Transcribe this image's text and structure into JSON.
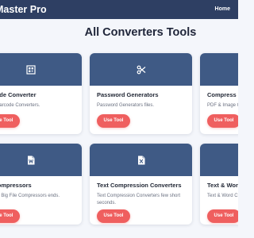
{
  "navbar": {
    "brand": "Master Pro",
    "home_link": "Home"
  },
  "page": {
    "title": "All Converters Tools"
  },
  "cards": [
    {
      "title": "e Code Converter",
      "description": "QR, Barcode Converters.",
      "button": "Use Tool",
      "icon": "qr-code-icon"
    },
    {
      "title": "Password Generators",
      "description": "Password Generators files.",
      "button": "Use Tool",
      "icon": "scissors-icon"
    },
    {
      "title": "Compress PD",
      "description": "PDF & Image C",
      "button": "Use Tool",
      "icon": "pdf-icon"
    },
    {
      "title": "le Compressors",
      "description": "onvert Big File Compressors ends.",
      "button": "Use Tool",
      "icon": "word-file-icon"
    },
    {
      "title": "Text Compression Converters",
      "description": "Text Compression Converters few short seconds.",
      "button": "Use Tool",
      "icon": "excel-file-icon"
    },
    {
      "title": "Text & Word",
      "description": "Text & Word C",
      "button": "Use Tool",
      "icon": "text-icon"
    }
  ],
  "colors": {
    "navbar": "#2e3f63",
    "card_header": "#3f5a85",
    "button": "#ef5f5f",
    "background": "#f4f6fb"
  }
}
